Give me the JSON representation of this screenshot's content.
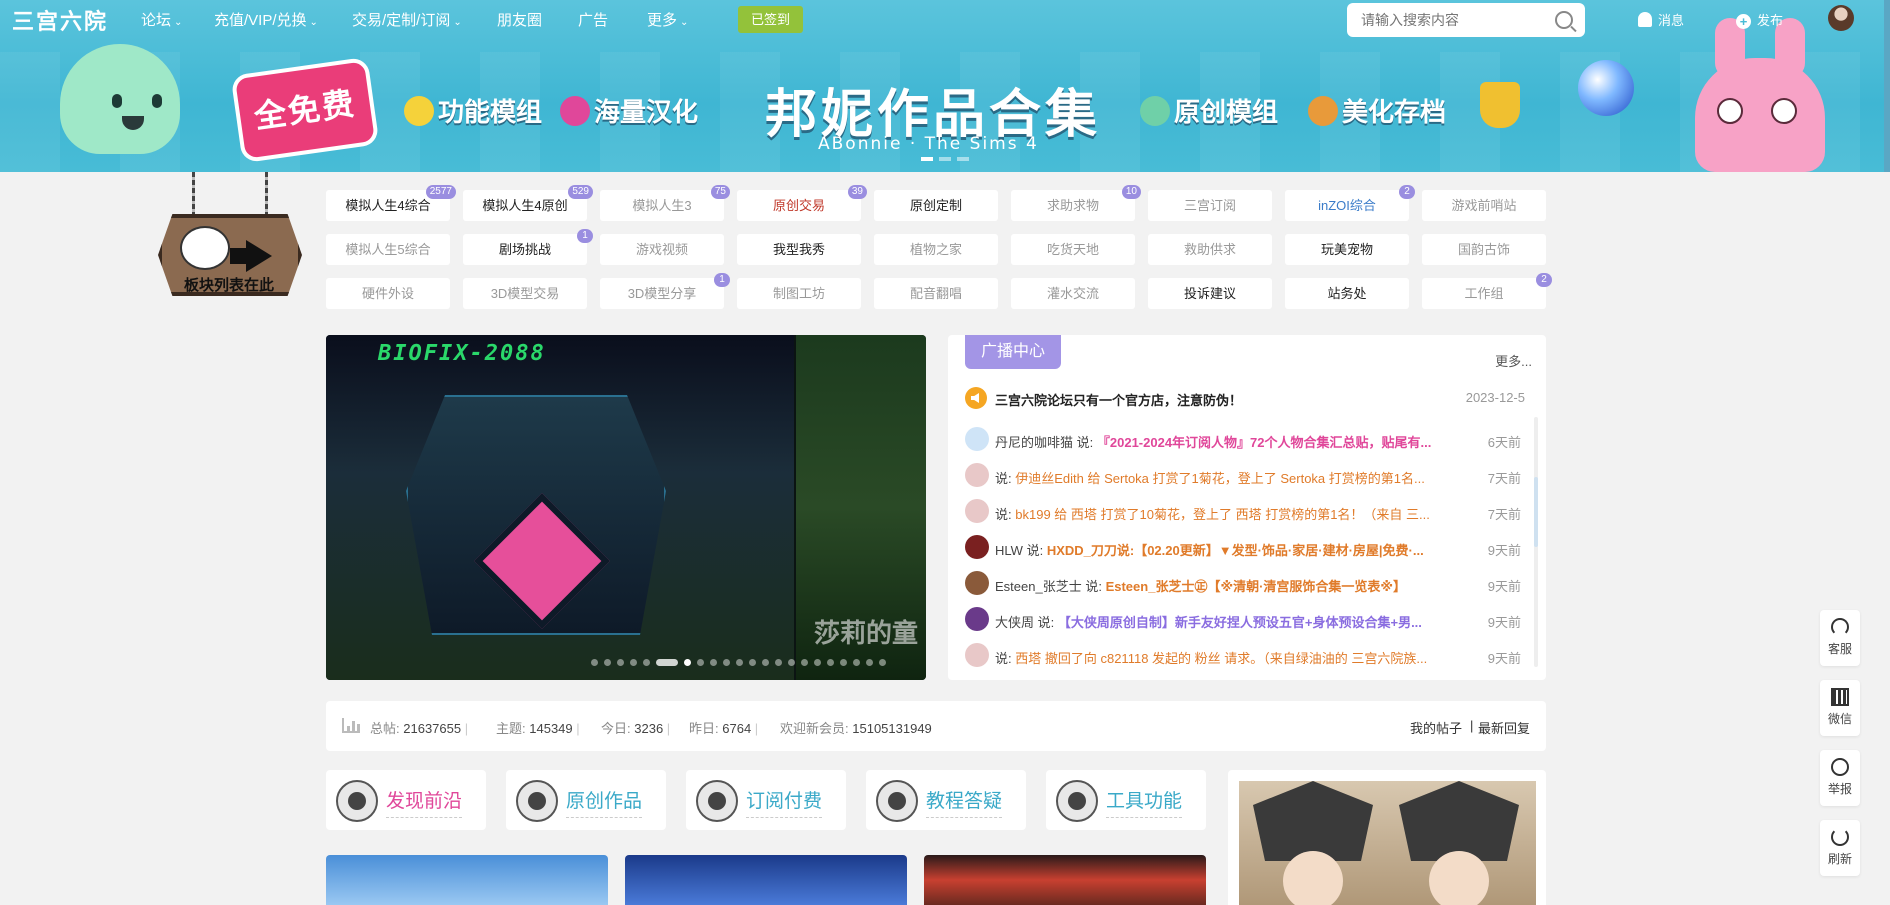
{
  "site": {
    "logo": "三宫六院",
    "nav": [
      {
        "label": "论坛",
        "caret": "⌄"
      },
      {
        "label": "充值/VIP/兑换",
        "caret": "⌄"
      },
      {
        "label": "交易/定制/订阅",
        "caret": "⌄"
      },
      {
        "label": "朋友圈",
        "caret": ""
      },
      {
        "label": "广告",
        "caret": ""
      },
      {
        "label": "更多",
        "caret": "⌄"
      }
    ],
    "signed_in_label": "已签到",
    "search_placeholder": "请输入搜索内容",
    "messages_label": "消息",
    "publish_label": "发布"
  },
  "banner": {
    "free_badge": "全免费",
    "features": [
      "功能模组",
      "海量汉化",
      "原创模组",
      "美化存档"
    ],
    "title": "邦妮作品合集",
    "subtitle": "ABonnie · The Sims 4",
    "sign_text": "板块列表在此"
  },
  "boards": [
    {
      "label": "模拟人生4综合",
      "count": "2577",
      "style": "dark"
    },
    {
      "label": "模拟人生4原创",
      "count": "529",
      "style": "dark"
    },
    {
      "label": "模拟人生3",
      "count": "75",
      "style": ""
    },
    {
      "label": "原创交易",
      "count": "39",
      "style": "red"
    },
    {
      "label": "原创定制",
      "count": "",
      "style": "dark"
    },
    {
      "label": "求助求物",
      "count": "10",
      "style": ""
    },
    {
      "label": "三宫订阅",
      "count": "",
      "style": ""
    },
    {
      "label": "inZOI综合",
      "count": "2",
      "style": "blue"
    },
    {
      "label": "游戏前哨站",
      "count": "",
      "style": ""
    },
    {
      "label": "模拟人生5综合",
      "count": "",
      "style": ""
    },
    {
      "label": "剧场挑战",
      "count": "1",
      "style": "dark"
    },
    {
      "label": "游戏视频",
      "count": "",
      "style": ""
    },
    {
      "label": "我型我秀",
      "count": "",
      "style": "dark"
    },
    {
      "label": "植物之家",
      "count": "",
      "style": ""
    },
    {
      "label": "吃货天地",
      "count": "",
      "style": ""
    },
    {
      "label": "救助供求",
      "count": "",
      "style": ""
    },
    {
      "label": "玩美宠物",
      "count": "",
      "style": "dark"
    },
    {
      "label": "国韵古饰",
      "count": "",
      "style": ""
    },
    {
      "label": "硬件外设",
      "count": "",
      "style": ""
    },
    {
      "label": "3D模型交易",
      "count": "",
      "style": ""
    },
    {
      "label": "3D模型分享",
      "count": "1",
      "style": ""
    },
    {
      "label": "制图工坊",
      "count": "",
      "style": ""
    },
    {
      "label": "配音翻唱",
      "count": "",
      "style": ""
    },
    {
      "label": "灌水交流",
      "count": "",
      "style": ""
    },
    {
      "label": "投诉建议",
      "count": "",
      "style": "dark"
    },
    {
      "label": "站务处",
      "count": "",
      "style": "dark"
    },
    {
      "label": "工作组",
      "count": "2",
      "style": ""
    }
  ],
  "slider": {
    "title": "BIOFIX-2088",
    "caption": "莎莉的童",
    "dot_count": 22,
    "active_dot": 6
  },
  "broadcast": {
    "tab": "广播中心",
    "more": "更多...",
    "notice": {
      "text": "三宫六院论坛只有一个官方店，注意防伪！",
      "date": "2023-12-5"
    },
    "items": [
      {
        "user": "丹尼的咖啡猫",
        "say": "说:",
        "msg": "『2021-2024年订阅人物』72个人物合集汇总贴，贴尾有...",
        "msg_style": "pk",
        "time": "6天前",
        "avatar": "#cfe4f7"
      },
      {
        "user": "",
        "say": "说:",
        "msg": "伊迪丝Edith 给 Sertoka 打赏了1菊花，登上了 Sertoka 打赏榜的第1名...",
        "msg_style": "mixed1",
        "time": "7天前",
        "avatar": "#e8c8c8"
      },
      {
        "user": "",
        "say": "说:",
        "msg": "bk199 给 西塔 打赏了10菊花，登上了 西塔 打赏榜的第1名！（来自 三...",
        "msg_style": "mixed2",
        "time": "7天前",
        "avatar": "#e8c8c8"
      },
      {
        "user": "HLW",
        "say": "说:",
        "msg": "HXDD_刀刀说:【02.20更新】▼发型·饰品·家居·建材·房屋|免费·...",
        "msg_style": "or",
        "time": "9天前",
        "avatar": "#7a2020"
      },
      {
        "user": "Esteen_张芝士",
        "say": "说:",
        "msg": "Esteen_张芝士㊣【※清朝·清宫服饰合集一览表※】",
        "msg_style": "or",
        "time": "9天前",
        "avatar": "#8a5a3a"
      },
      {
        "user": "大侠周",
        "say": "说:",
        "msg": "【大侠周原创自制】新手友好捏人预设五官+身体预设合集+男...",
        "msg_style": "pu",
        "time": "9天前",
        "avatar": "#6a3a8a"
      },
      {
        "user": "",
        "say": "说:",
        "msg": "西塔 撤回了向 c821118 发起的 粉丝 请求。（来自绿油油的 三宫六院族...",
        "msg_style": "mixed3",
        "time": "9天前",
        "avatar": "#e8c8c8"
      }
    ]
  },
  "stats": {
    "total_label": "总帖:",
    "total": "21637655",
    "topic_label": "主题:",
    "topic": "145349",
    "today_label": "今日:",
    "today": "3236",
    "yesterday_label": "昨日:",
    "yesterday": "6764",
    "welcome_label": "欢迎新会员:",
    "welcome": "15105131949",
    "my_posts": "我的帖子",
    "latest_reply": "最新回复"
  },
  "categories": [
    {
      "label": "发现前沿",
      "color": "#e0479a"
    },
    {
      "label": "原创作品",
      "color": "#3aa9c8"
    },
    {
      "label": "订阅付费",
      "color": "#3aa9c8"
    },
    {
      "label": "教程答疑",
      "color": "#3aa9c8"
    },
    {
      "label": "工具功能",
      "color": "#3aa9c8"
    }
  ],
  "tools": [
    {
      "label": "客服",
      "icon": "headset-icon"
    },
    {
      "label": "微信",
      "icon": "qrcode-icon"
    },
    {
      "label": "举报",
      "icon": "chat-icon"
    },
    {
      "label": "刷新",
      "icon": "refresh-icon"
    }
  ],
  "colors": {
    "header_bg": "#48bcd6",
    "signed_bg": "#93c23a",
    "badge_bg": "#9a8ee0",
    "broadcast_tab": "#a395e6"
  }
}
